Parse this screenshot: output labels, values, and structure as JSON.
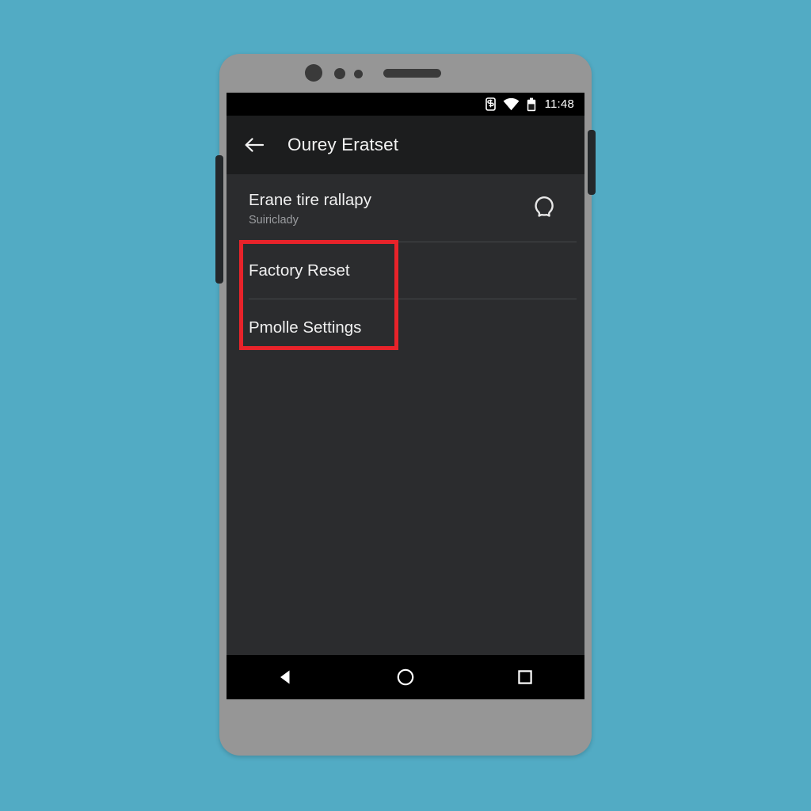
{
  "canvas": {
    "background_color": "#52abc4"
  },
  "device": {
    "body_color": "#969696",
    "hardware": {
      "front_camera": "front-camera",
      "proximity_sensor": "proximity-sensor",
      "light_sensor": "light-sensor",
      "earpiece_speaker": "earpiece-speaker",
      "volume_button": "volume-button",
      "power_button": "power-button"
    }
  },
  "status_bar": {
    "background_color": "#000000",
    "clock": "11:48",
    "icons": [
      {
        "name": "sim-card-icon",
        "label": "SIM card"
      },
      {
        "name": "wifi-icon",
        "label": "Wi-Fi"
      },
      {
        "name": "battery-icon",
        "label": "Battery"
      }
    ]
  },
  "app_bar": {
    "background_color": "#1c1d1e",
    "back_icon": "arrow-back-icon",
    "title": "Ourey Eratset"
  },
  "screen": {
    "background_color": "#2b2c2e"
  },
  "list": {
    "rows": [
      {
        "name": "account",
        "title": "Erane tire rallapy",
        "subtitle": "Suiriclady",
        "action_icon": "chat-bubble-icon"
      },
      {
        "name": "factory-reset",
        "title": "Factory Reset",
        "subtitle": "",
        "action_icon": ""
      },
      {
        "name": "profile-settings",
        "title": "Pmolle Settings",
        "subtitle": "",
        "action_icon": ""
      }
    ]
  },
  "annotation": {
    "type": "rectangle-highlight",
    "color": "#e8232a",
    "targets": [
      "Factory Reset",
      "Pmolle Settings"
    ]
  },
  "nav_bar": {
    "background_color": "#000000",
    "buttons": [
      {
        "name": "back-nav-button",
        "icon": "triangle-back-icon"
      },
      {
        "name": "home-nav-button",
        "icon": "circle-home-icon"
      },
      {
        "name": "recents-nav-button",
        "icon": "square-recents-icon"
      }
    ]
  }
}
